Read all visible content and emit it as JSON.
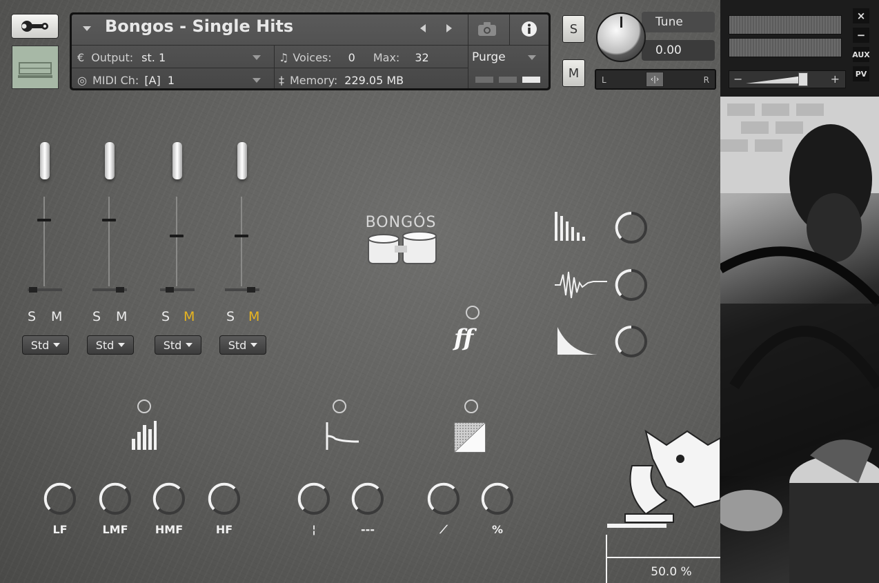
{
  "header": {
    "instrument_title": "Bongos - Single Hits",
    "output_label": "Output:",
    "output_value": "st. 1",
    "voices_label": "Voices:",
    "voices_value": "0",
    "max_label": "Max:",
    "max_value": "32",
    "midi_label": "MIDI Ch:",
    "midi_value": "[A]  1",
    "memory_label": "Memory:",
    "memory_value": "229.05 MB",
    "purge_label": "Purge",
    "solo_label": "S",
    "mute_label": "M",
    "tune_label": "Tune",
    "tune_value": "0.00",
    "pan_left": "L",
    "pan_right": "R"
  },
  "side_panel": {
    "close_label": "×",
    "minimize_label": "−",
    "aux_label": "AUX",
    "pv_label": "PV",
    "vol_minus": "−",
    "vol_plus": "+"
  },
  "channels": [
    {
      "solo": "S",
      "mute": "M",
      "mute_active": false,
      "mode": "Std"
    },
    {
      "solo": "S",
      "mute": "M",
      "mute_active": false,
      "mode": "Std"
    },
    {
      "solo": "S",
      "mute": "M",
      "mute_active": true,
      "mode": "Std"
    },
    {
      "solo": "S",
      "mute": "M",
      "mute_active": true,
      "mode": "Std"
    }
  ],
  "logo": {
    "text": "BONGÓS"
  },
  "dynamics_label": "ff",
  "eq_knobs": [
    {
      "label": "LF"
    },
    {
      "label": "LMF"
    },
    {
      "label": "HMF"
    },
    {
      "label": "HF"
    }
  ],
  "reverb_knobs": [
    {
      "label": "¦"
    },
    {
      "label": "---"
    }
  ],
  "comp_knobs": [
    {
      "label": "⟋"
    },
    {
      "label": "%"
    }
  ],
  "zoom": "50.0 %",
  "colors": {
    "accent_mute": "#e8b520",
    "text": "#ececec",
    "panel": "#5e5e5c"
  }
}
